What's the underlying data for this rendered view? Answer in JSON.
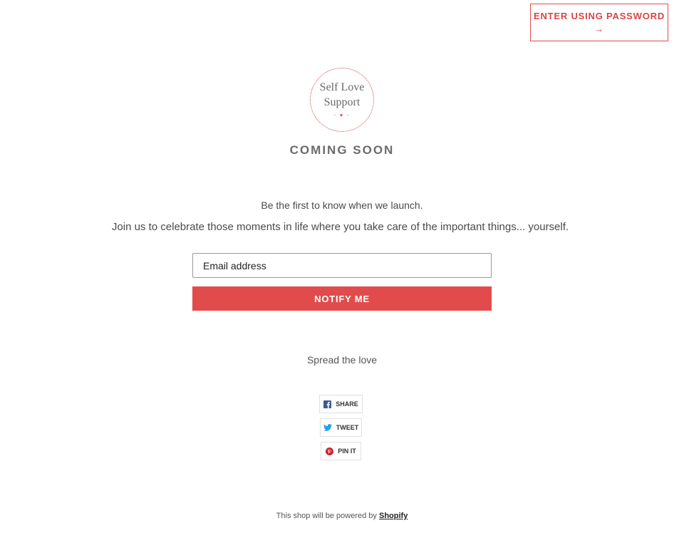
{
  "header": {
    "password_button_label": "ENTER USING PASSWORD",
    "password_button_arrow": "→"
  },
  "logo": {
    "line1": "Self Love",
    "line2": "Support"
  },
  "hero": {
    "title": "COMING SOON",
    "subtitle": "Be the first to know when we launch.",
    "description": "Join us to celebrate those moments in life where you take care of the important things... yourself."
  },
  "signup": {
    "email_placeholder": "Email address",
    "email_value": "",
    "button_label": "NOTIFY ME"
  },
  "social": {
    "heading": "Spread the love",
    "share_label": "SHARE",
    "tweet_label": "TWEET",
    "pin_label": "PIN IT"
  },
  "footer": {
    "text": "This shop will be powered by",
    "link_label": "Shopify"
  },
  "colors": {
    "accent": "#e24b4b",
    "facebook": "#3b5998",
    "twitter": "#1da1f2",
    "pinterest": "#cb2027"
  },
  "icons": {
    "share": "facebook-icon",
    "tweet": "twitter-icon",
    "pin": "pinterest-icon"
  }
}
